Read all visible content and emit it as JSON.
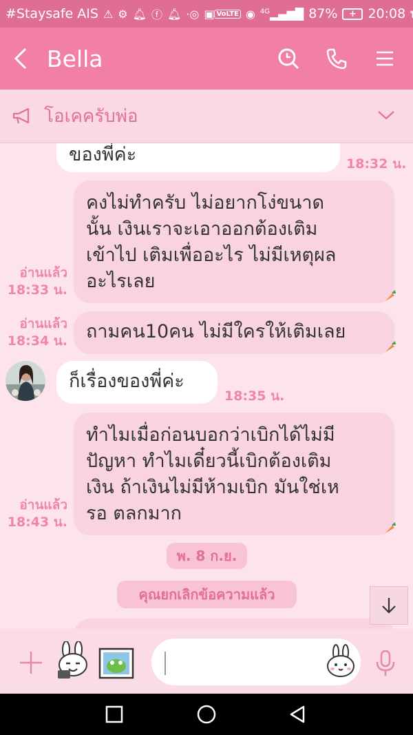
{
  "status_bar": {
    "carrier": "#Staysafe AIS",
    "network": "4G",
    "battery": "87%",
    "time": "20:08 น."
  },
  "header": {
    "title": "Bella",
    "icons": [
      "back-icon",
      "search-icon",
      "phone-icon",
      "menu-icon"
    ]
  },
  "announcement": {
    "text": "โอเคครับพ่อ",
    "icon": "megaphone-icon"
  },
  "messages": [
    {
      "side": "in",
      "text": "ของพี่ค่ะ",
      "time": "18:32 น."
    },
    {
      "side": "out",
      "lines": [
        "คงไม่ทำครับ ไม่อยากโง่ขนาด",
        "นั้น เงินเราจะเอาออกต้องเติม",
        "เข้าไป เติมเพื่ออะไร ไม่มีเหตุผล",
        "อะไรเลย"
      ],
      "read": "อ่านแล้ว",
      "time": "18:33 น."
    },
    {
      "side": "out",
      "text": "ถามคน10คน ไม่มีใครให้เติมเลย",
      "read": "อ่านแล้ว",
      "time": "18:34 น."
    },
    {
      "side": "in",
      "text": "ก็เรื่องของพี่ค่ะ",
      "time": "18:35 น."
    },
    {
      "side": "out",
      "lines": [
        "ทำไมเมื่อก่อนบอกว่าเบิกได้ไม่มี",
        "ปัญหา ทำไมเดี๋ยวนี้เบิกต้องเติม",
        "เงิน ถ้าเงินไม่มีห้ามเบิก มันใช่เห",
        "รอ ตลกมาก"
      ],
      "read": "อ่านแล้ว",
      "time": "18:43 น."
    }
  ],
  "date_chip": "พ. 8 ก.ย.",
  "system_message": "คุณยกเลิกข้อความแล้ว",
  "input": {
    "value": "",
    "placeholder": ""
  },
  "colors": {
    "status_bar": "#e06d93",
    "header": "#f27fa6",
    "background": "#fde3ec",
    "bubble_out": "#f9d3e1",
    "bubble_in": "#ffffff",
    "accent_text": "#ef86a9"
  }
}
